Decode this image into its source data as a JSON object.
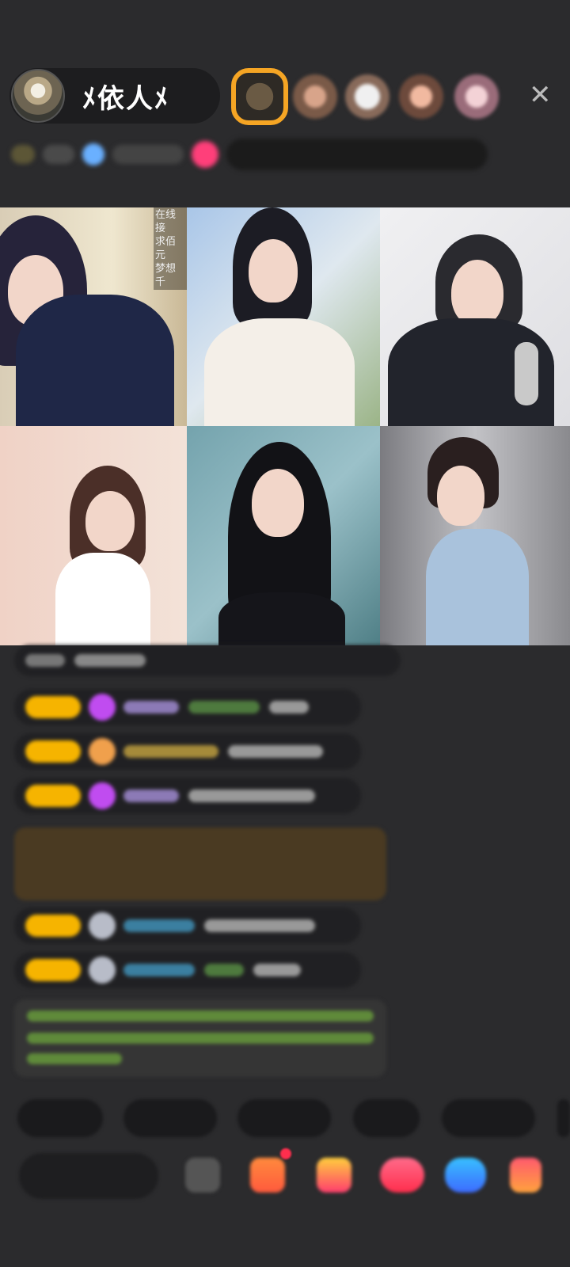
{
  "header": {
    "host_name": "ﾒ依人ﾒ",
    "close_icon": "close-icon"
  },
  "video_grid": {
    "tiles": [
      {
        "overlay_lines": [
          "在线接",
          "求佰元",
          "梦想千"
        ]
      },
      {
        "overlay_lines": []
      },
      {
        "overlay_lines": []
      },
      {
        "overlay_lines": []
      },
      {
        "overlay_lines": []
      },
      {
        "overlay_lines": []
      }
    ]
  },
  "colors": {
    "background": "#2b2b2d",
    "badge": "#f6b400",
    "gift_pink": "#ff3f7a",
    "system_message": "#4a3a22"
  }
}
